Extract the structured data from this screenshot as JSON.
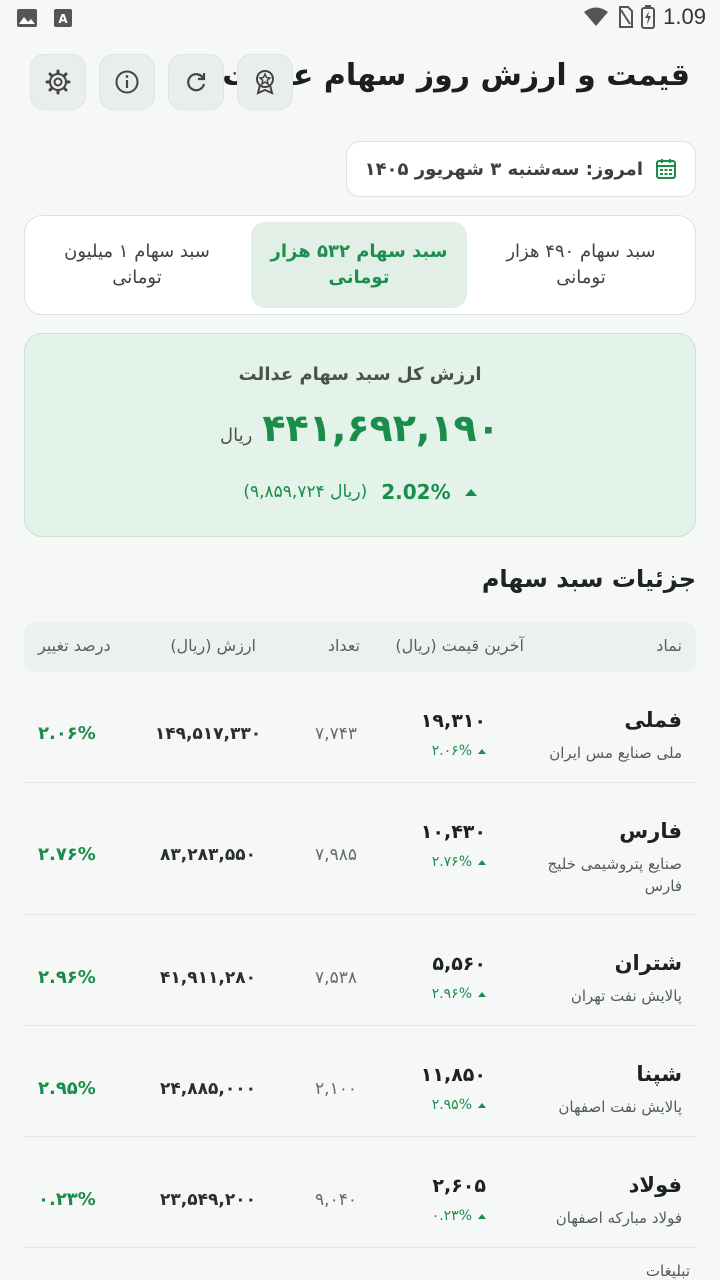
{
  "status_bar": {
    "time": "1.09",
    "icons": [
      "image-icon",
      "a-icon",
      "wifi-icon",
      "no-sim-icon",
      "battery-icon"
    ]
  },
  "header": {
    "title": "قیمت و ارزش روز سهام عدالت",
    "buttons": [
      "award-icon",
      "refresh-icon",
      "info-icon",
      "settings-icon"
    ]
  },
  "date": {
    "text": "امروز: سه‌شنبه ۳ شهریور ۱۴۰۵",
    "icon": "calendar-icon"
  },
  "tabs": [
    {
      "label": "سبد سهام ۴۹۰ هزار تومانی",
      "active": false
    },
    {
      "label": "سبد سهام ۵۳۲ هزار تومانی",
      "active": true
    },
    {
      "label": "سبد سهام ۱ میلیون تومانی",
      "active": false
    }
  ],
  "total": {
    "label": "ارزش کل سبد سهام عدالت",
    "value": "۴۴۱,۶۹۲,۱۹۰",
    "unit": "ریال",
    "change_percent": "2.02%",
    "change_abs": "(۹,۸۵۹,۷۲۴ ریال)"
  },
  "details": {
    "title": "جزئیات سبد سهام",
    "columns": {
      "symbol": "نماد",
      "last_price": "آخرین قیمت (ریال)",
      "count": "تعداد",
      "value": "ارزش (ریال)",
      "change": "درصد تغییر"
    },
    "rows": [
      {
        "symbol": "فملی",
        "name": "ملی صنایع مس ایران",
        "price": "۱۹,۳۱۰",
        "price_change": "۲.۰۶%",
        "count": "۷,۷۴۳",
        "value": "۱۴۹,۵۱۷,۳۳۰",
        "change": "۲.۰۶%"
      },
      {
        "symbol": "فارس",
        "name": "صنایع پتروشیمی خلیج فارس",
        "price": "۱۰,۴۳۰",
        "price_change": "۲.۷۶%",
        "count": "۷,۹۸۵",
        "value": "۸۳,۲۸۳,۵۵۰",
        "change": "۲.۷۶%"
      },
      {
        "symbol": "شتران",
        "name": "پالایش نفت تهران",
        "price": "۵,۵۶۰",
        "price_change": "۲.۹۶%",
        "count": "۷,۵۳۸",
        "value": "۴۱,۹۱۱,۲۸۰",
        "change": "۲.۹۶%"
      },
      {
        "symbol": "شپنا",
        "name": "پالایش نفت اصفهان",
        "price": "۱۱,۸۵۰",
        "price_change": "۲.۹۵%",
        "count": "۲,۱۰۰",
        "value": "۲۴,۸۸۵,۰۰۰",
        "change": "۲.۹۵%"
      },
      {
        "symbol": "فولاد",
        "name": "فولاد مبارکه اصفهان",
        "price": "۲,۶۰۵",
        "price_change": "۰.۲۳%",
        "count": "۹,۰۴۰",
        "value": "۲۳,۵۴۹,۲۰۰",
        "change": "۰.۲۳%"
      }
    ]
  },
  "ads_label": "تبلیغات",
  "colors": {
    "accent": "#1b8d4b",
    "card_bg": "#e4f3e9",
    "background": "#f6f8f7"
  }
}
